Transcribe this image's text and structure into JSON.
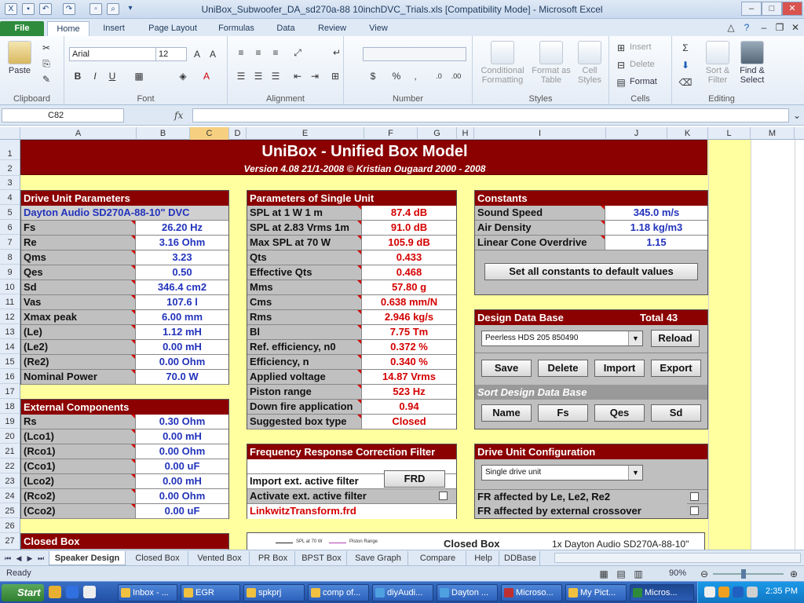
{
  "window": {
    "title": "UniBox_Subwoofer_DA_sd270a-88 10inchDVC_Trials.xls  [Compatibility Mode]  -  Microsoft Excel",
    "controls": [
      "–",
      "□",
      "✕"
    ]
  },
  "ribbon": {
    "tabs": [
      "File",
      "Home",
      "Insert",
      "Page Layout",
      "Formulas",
      "Data",
      "Review",
      "View"
    ],
    "active_tab": "Home",
    "clipboard": {
      "paste": "Paste",
      "label": "Clipboard"
    },
    "font": {
      "name": "Arial",
      "size": "12",
      "label": "Font"
    },
    "alignment": {
      "label": "Alignment"
    },
    "number": {
      "label": "Number",
      "currency": "$",
      "percent": "%",
      "comma": ","
    },
    "styles": {
      "label": "Styles",
      "cond": "Conditional Formatting",
      "table": "Format as Table",
      "cell": "Cell Styles"
    },
    "cells": {
      "label": "Cells",
      "insert": "Insert",
      "delete": "Delete",
      "format": "Format"
    },
    "editing": {
      "label": "Editing",
      "sort": "Sort & Filter",
      "find": "Find & Select"
    }
  },
  "formula_bar": {
    "name_box": "C82",
    "fx": "fx",
    "value": ""
  },
  "grid": {
    "columns": [
      "A",
      "B",
      "C",
      "D",
      "E",
      "F",
      "G",
      "H",
      "I",
      "J",
      "K",
      "L",
      "M"
    ],
    "selected_col": "C",
    "rows": [
      "1",
      "2",
      "3",
      "4",
      "5",
      "6",
      "7",
      "8",
      "9",
      "10",
      "11",
      "12",
      "13",
      "14",
      "15",
      "16",
      "17",
      "18",
      "19",
      "20",
      "21",
      "22",
      "23",
      "24",
      "25",
      "26",
      "27"
    ]
  },
  "header": {
    "title": "UniBox   -   Unified Box Model",
    "version": "Version 4.08  21/1-2008       ©  Kristian Ougaard  2000 - 2008"
  },
  "drive_unit": {
    "title": "Drive Unit Parameters",
    "model": "Dayton Audio SD270A-88-10\" DVC",
    "rows": [
      {
        "label": "Fs",
        "value": "26.20 Hz"
      },
      {
        "label": "Re",
        "value": "3.16 Ohm"
      },
      {
        "label": "Qms",
        "value": "3.23"
      },
      {
        "label": "Qes",
        "value": "0.50"
      },
      {
        "label": "Sd",
        "value": "346.4 cm2"
      },
      {
        "label": "Vas",
        "value": "107.6 l"
      },
      {
        "label": "Xmax peak",
        "value": "6.00 mm"
      },
      {
        "label": "(Le)",
        "value": "1.12 mH"
      },
      {
        "label": "(Le2)",
        "value": "0.00 mH"
      },
      {
        "label": "(Re2)",
        "value": "0.00 Ohm"
      },
      {
        "label": "Nominal Power",
        "value": "70.0 W"
      }
    ]
  },
  "external": {
    "title": "External Components",
    "rows": [
      {
        "label": "Rs",
        "value": "0.30 Ohm"
      },
      {
        "label": "(Lco1)",
        "value": "0.00 mH"
      },
      {
        "label": "(Rco1)",
        "value": "0.00 Ohm"
      },
      {
        "label": "(Cco1)",
        "value": "0.00 uF"
      },
      {
        "label": "(Lco2)",
        "value": "0.00 mH"
      },
      {
        "label": "(Rco2)",
        "value": "0.00 Ohm"
      },
      {
        "label": "(Cco2)",
        "value": "0.00 uF"
      }
    ]
  },
  "closed_box": {
    "title": "Closed Box"
  },
  "single_unit": {
    "title": "Parameters of Single Unit",
    "rows": [
      {
        "label": "SPL at 1 W 1 m",
        "value": "87.4 dB"
      },
      {
        "label": "SPL at 2.83 Vrms 1m",
        "value": "91.0 dB"
      },
      {
        "label": "Max SPL at 70 W",
        "value": "105.9 dB"
      },
      {
        "label": "Qts",
        "value": "0.433"
      },
      {
        "label": "Effective Qts",
        "value": "0.468"
      },
      {
        "label": "Mms",
        "value": "57.80 g"
      },
      {
        "label": "Cms",
        "value": "0.638 mm/N"
      },
      {
        "label": "Rms",
        "value": "2.946 kg/s"
      },
      {
        "label": "Bl",
        "value": "7.75 Tm"
      },
      {
        "label": "Ref. efficiency, n0",
        "value": "0.372 %"
      },
      {
        "label": "Efficiency, n",
        "value": "0.340 %"
      },
      {
        "label": "Applied voltage",
        "value": "14.87 Vrms"
      },
      {
        "label": "Piston range",
        "value": "523 Hz"
      },
      {
        "label": "Down fire application",
        "value": "0.94"
      },
      {
        "label": "Suggested box type",
        "value": "Closed"
      }
    ]
  },
  "freq_corr": {
    "title": "Frequency Response Correction Filter",
    "import_label": "Import ext. active filter",
    "frd_button": "FRD",
    "activate_label": "Activate ext. active filter",
    "file": "LinkwitzTransform.frd"
  },
  "constants": {
    "title": "Constants",
    "rows": [
      {
        "label": "Sound Speed",
        "value": "345.0 m/s"
      },
      {
        "label": "Air Density",
        "value": "1.18 kg/m3"
      },
      {
        "label": "Linear Cone Overdrive",
        "value": "1.15"
      }
    ],
    "default_button": "Set all constants to default values"
  },
  "design_db": {
    "title": "Design Data Base",
    "total": "Total 43",
    "selected": "Peerless HDS 205 850490",
    "reload": "Reload",
    "save": "Save",
    "delete": "Delete",
    "import": "Import",
    "export": "Export",
    "sort_title": "Sort Design Data Base",
    "sort_name": "Name",
    "sort_fs": "Fs",
    "sort_qes": "Qes",
    "sort_sd": "Sd"
  },
  "drive_config": {
    "title": "Drive Unit Configuration",
    "selected": "Single drive unit",
    "fr_le": "FR affected by Le, Le2, Re2",
    "fr_ext": "FR affected by external crossover"
  },
  "chart_preview": {
    "title": "Closed Box",
    "subtitle": "1x Dayton Audio SD270A-88-10\"",
    "legend1": "SPL at 70 W",
    "legend2": "Piston Range"
  },
  "sheet_tabs": [
    "Speaker Design",
    "Closed Box",
    "Vented Box",
    "PR Box",
    "BPST Box",
    "Save Graph",
    "Compare",
    "Help",
    "DDBase"
  ],
  "active_sheet": "Speaker Design",
  "status": {
    "ready": "Ready",
    "zoom": "90%"
  },
  "taskbar": {
    "start": "Start",
    "items": [
      "Inbox - ...",
      "EGR",
      "spkprj",
      "comp of...",
      "diyAudi...",
      "Dayton ...",
      "Microso...",
      "My Pict...",
      "Micros..."
    ],
    "clock": "2:35 PM"
  },
  "colors": {
    "header_red": "#8b0000",
    "panel_grey": "#c0c0c0",
    "sheet_yellow": "#ffffa0",
    "value_blue": "#2233bb",
    "value_red": "#d40000"
  }
}
